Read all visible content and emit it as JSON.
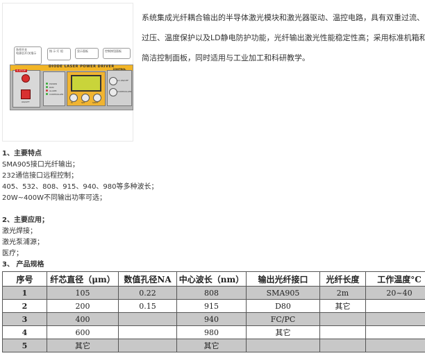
{
  "product_image": {
    "callouts": [
      "急停开关\n电源总开/关指示",
      "指 示 灯 组",
      "显示面板",
      "控制按钮面板"
    ],
    "panel_title": "DIODE LASER POWER DRIVER",
    "estop_label": "E-STOP",
    "control_label": "CONTROL",
    "leds": [
      "POWER",
      "RUN",
      "ALARM",
      "CONTROLLER"
    ],
    "ctrl_items": [
      "LC.ON/OFF",
      "CONTROLLER"
    ],
    "key_labels": [
      "M",
      "SET",
      "SHIFT"
    ],
    "switch_label": "ON/OFF"
  },
  "description": {
    "lines": [
      "系统集成光纤耦合输出的半导体激光模块和激光器驱动、温控电路，具有双重过流、",
      "过压、温度保护以及LD静电防护功能，光纤输出激光性能稳定性高；采用标准机箱和",
      "简洁控制面板，同时适用与工业加工和科研教学。"
    ]
  },
  "features": {
    "heading": "1、主要特点",
    "items": [
      "SMA905接口光纤输出；",
      "232通信接口远程控制；",
      "405、532、808、915、940、980等多种波长；",
      "20W~400W不同输出功率可选；"
    ]
  },
  "applications": {
    "heading": "2、主要应用；",
    "items": [
      "激光焊接；",
      "激光泵浦源；",
      "医疗；"
    ]
  },
  "specs": {
    "heading": "3、 产品规格",
    "columns": [
      "序号",
      "纤芯直径（μm）",
      "数值孔径NA",
      "中心波长（nm）",
      "输出光纤接口",
      "光纤长度",
      "工作温度°C"
    ],
    "rows": [
      [
        "1",
        "105",
        "0.22",
        "808",
        "SMA905",
        "2m",
        "20~40"
      ],
      [
        "2",
        "200",
        "0.15",
        "915",
        "D80",
        "其它",
        ""
      ],
      [
        "3",
        "400",
        "",
        "940",
        "FC/PC",
        "",
        ""
      ],
      [
        "4",
        "600",
        "",
        "980",
        "其它",
        "",
        ""
      ],
      [
        "5",
        "其它",
        "",
        "其它",
        "",
        "",
        ""
      ]
    ]
  }
}
